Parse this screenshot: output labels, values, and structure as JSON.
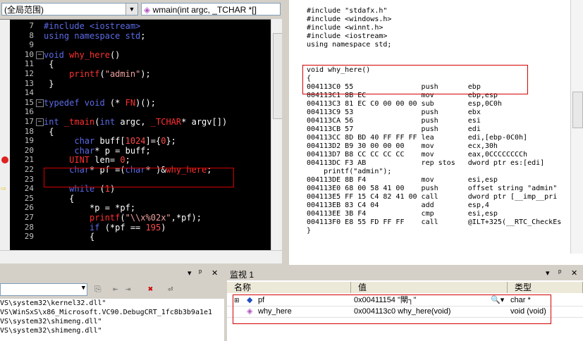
{
  "editor": {
    "scope_combo": "(全局范围)",
    "func_combo": "wmain(int argc, _TCHAR *[]",
    "lines": [
      {
        "n": "7",
        "html": "<span class='kw'>#include &lt;iostream&gt;</span>"
      },
      {
        "n": "8",
        "html": "<span class='kw'>using namespace std</span>;"
      },
      {
        "n": "9",
        "html": ""
      },
      {
        "n": "10",
        "html": "<span class='kw'>void</span> <span class='red'>why_here</span>()"
      },
      {
        "n": "11",
        "html": " {"
      },
      {
        "n": "12",
        "html": "     <span class='red'>printf</span>(<span class='str'>\"admin\"</span>);"
      },
      {
        "n": "13",
        "html": " }"
      },
      {
        "n": "14",
        "html": ""
      },
      {
        "n": "15",
        "html": "<span class='kw'>typedef void</span> (* <span class='red'>FN</span>)();"
      },
      {
        "n": "16",
        "html": ""
      },
      {
        "n": "17",
        "html": "<span class='kw'>int</span> <span class='red'>_tmain</span>(<span class='kw'>int</span> argc, <span class='red'>_TCHAR</span>* argv[])"
      },
      {
        "n": "18",
        "html": " {"
      },
      {
        "n": "19",
        "html": "      <span class='kw'>char</span> buff[<span class='num'>1024</span>]={<span class='num'>0</span>};"
      },
      {
        "n": "20",
        "html": "      <span class='kw'>char</span>* p = buff;"
      },
      {
        "n": "21",
        "html": "     <span class='red'>UINT</span> len= <span class='num'>0</span>;"
      },
      {
        "n": "22",
        "html": "     <span class='kw'>char</span>* pf =(<span class='kw'>char</span>* )&amp;<span class='red'>why_here</span>;"
      },
      {
        "n": "23",
        "html": ""
      },
      {
        "n": "24",
        "html": "     <span class='kw'>while</span> (<span class='num'>1</span>)"
      },
      {
        "n": "25",
        "html": "     {"
      },
      {
        "n": "26",
        "html": "         *p = *pf;"
      },
      {
        "n": "27",
        "html": "         <span class='red'>printf</span>(<span class='str'>\"\\\\x%02x\"</span>,*pf);"
      },
      {
        "n": "28",
        "html": "         <span class='kw'>if</span> (*pf == <span class='num'>195</span>)"
      },
      {
        "n": "29",
        "html": "         {"
      }
    ]
  },
  "disasm": {
    "text": "#include \"stdafx.h\"\n#include <windows.h>\n#include <winnt.h>\n#include <iostream>\nusing namespace std;\n\n\nvoid why_here()\n{\n004113C0 55                push       ebp\n004113C1 8B EC             mov        ebp,esp\n004113C3 81 EC C0 00 00 00 sub        esp,0C0h\n004113C9 53                push       ebx\n004113CA 56                push       esi\n004113CB 57                push       edi\n004113CC 8D BD 40 FF FF FF lea        edi,[ebp-0C0h]\n004113D2 B9 30 00 00 00    mov        ecx,30h\n004113D7 B8 CC CC CC CC    mov        eax,0CCCCCCCCh\n004113DC F3 AB             rep stos   dword ptr es:[edi]\n    printf(\"admin\");\n004113DE 8B F4             mov        esi,esp\n004113E0 68 00 58 41 00    push       offset string \"admin\"\n004113E5 FF 15 C4 82 41 00 call       dword ptr [__imp__pri\n004113EB 83 C4 04          add        esp,4\n004113EE 3B F4             cmp        esi,esp\n004113F0 E8 55 FD FF FF    call       @ILT+325(__RTC_CheckEs\n}"
  },
  "output": {
    "lines": [
      "VS\\system32\\kernel32.dll\"",
      "VS\\WinSxS\\x86_Microsoft.VC90.DebugCRT_1fc8b3b9a1e1",
      "VS\\system32\\shimeng.dll\"",
      "VS\\system32\\shimeng.dll\""
    ]
  },
  "watch": {
    "title": "监视 1",
    "col_name": "名称",
    "col_value": "值",
    "col_type": "类型",
    "rows": [
      {
        "name": "pf",
        "value": "0x00411154 \"閘┐\"",
        "type": "char *"
      },
      {
        "name": "why_here",
        "value": "0x004113c0 why_here(void)",
        "type": "void (void)"
      }
    ]
  },
  "colors": {
    "keyword": "#5b6be6",
    "identifier": "#ff3030",
    "string": "#f0a0a0",
    "highlight_box": "#d40000"
  }
}
